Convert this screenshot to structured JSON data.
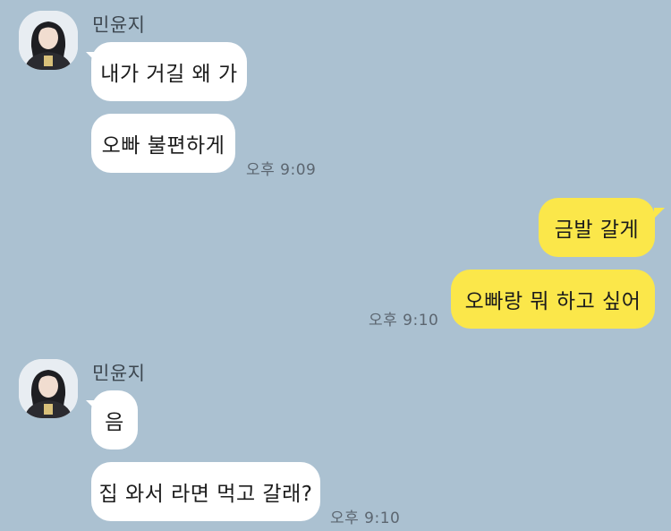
{
  "groups": [
    {
      "sender": "민윤지",
      "messages": [
        "내가 거길 왜 가",
        "오빠 불편하게"
      ],
      "time": "오후 9:09"
    },
    {
      "messages": [
        "금발 갈게",
        "오빠랑 뭐 하고 싶어"
      ],
      "time": "오후 9:10"
    },
    {
      "sender": "민윤지",
      "messages": [
        "음",
        "집 와서 라면 먹고 갈래?"
      ],
      "time": "오후 9:10"
    }
  ],
  "colors": {
    "background": "#abc1d1",
    "incoming_bubble": "#ffffff",
    "outgoing_bubble": "#fbe74a"
  }
}
